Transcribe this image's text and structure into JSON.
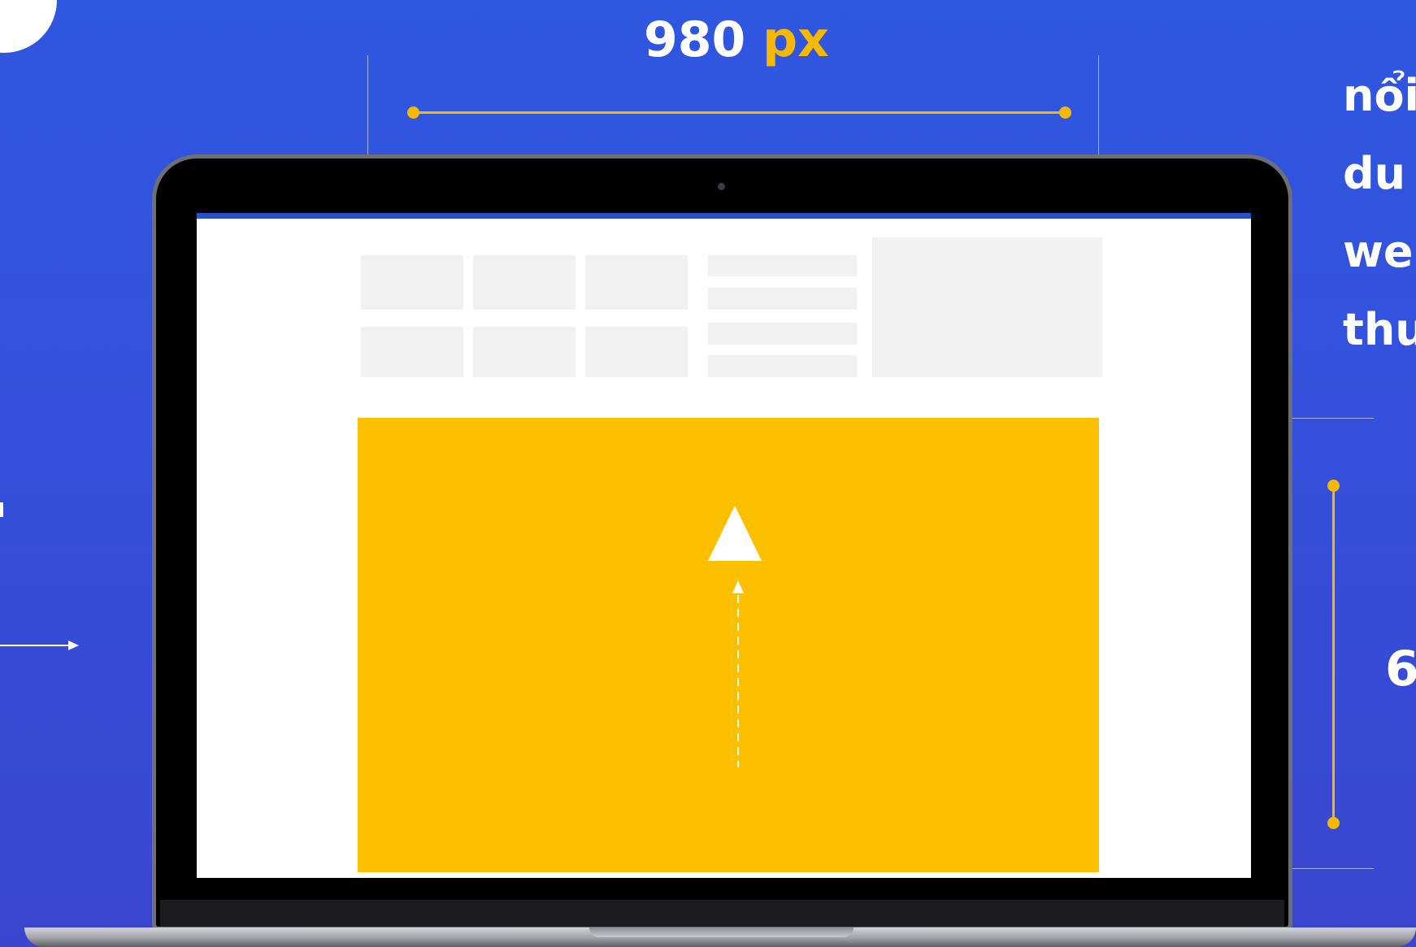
{
  "dimension_top": {
    "value": "980",
    "unit": "px"
  },
  "dimension_right": {
    "value": "6"
  },
  "side_text_lines": [
    "nổi",
    "du",
    "we",
    "thu"
  ],
  "colors": {
    "background": "#3450dc",
    "accent": "#f6b800",
    "banner": "#fdc000",
    "tile": "#f1f1f1"
  },
  "icons": {
    "upload_arrow": "triangle-up-icon",
    "dashed_arrow": "dashed-arrow-up-icon",
    "left_arrow": "arrow-right-icon"
  }
}
